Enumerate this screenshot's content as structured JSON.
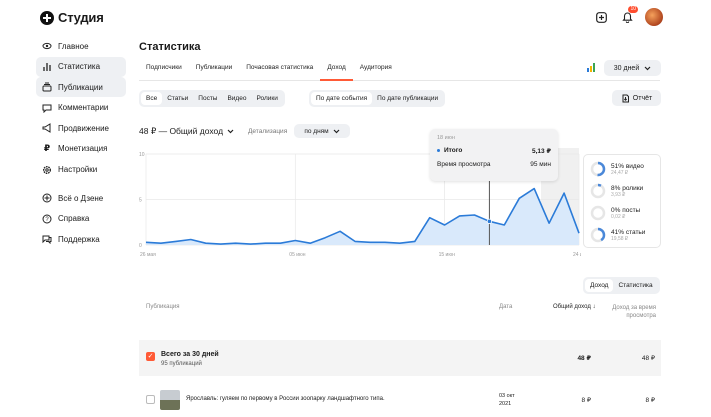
{
  "app": {
    "logo_text": "Студия",
    "notif_count": "10"
  },
  "sidebar": {
    "items": [
      {
        "label": "Главное",
        "icon": "eye-icon"
      },
      {
        "label": "Статистика",
        "icon": "stats-icon"
      },
      {
        "label": "Публикации",
        "icon": "publications-icon"
      },
      {
        "label": "Комментарии",
        "icon": "comment-icon"
      },
      {
        "label": "Продвижение",
        "icon": "megaphone-icon"
      },
      {
        "label": "Монетизация",
        "icon": "ruble-icon"
      },
      {
        "label": "Настройки",
        "icon": "gear-icon"
      },
      {
        "label": "Всё о Дзене",
        "icon": "zen-icon"
      },
      {
        "label": "Справка",
        "icon": "help-icon"
      },
      {
        "label": "Поддержка",
        "icon": "chat-icon"
      }
    ]
  },
  "page": {
    "title": "Статистика"
  },
  "tabs": [
    "Подписчики",
    "Публикации",
    "Почасовая статистика",
    "Доход",
    "Аудитория"
  ],
  "period": "30 дней",
  "filters": [
    "Все",
    "Статьи",
    "Посты",
    "Видео",
    "Ролики"
  ],
  "date_filters": [
    "По дате события",
    "По дате публикации"
  ],
  "report_label": "Отчёт",
  "income": {
    "title": "48 ₽ — Общий доход",
    "detail_label": "Детализация",
    "detail_value": "по дням"
  },
  "tooltip": {
    "date": "18 июн",
    "total_label": "Итого",
    "total_value": "5,13 ₽",
    "time_label": "Время просмотра",
    "time_value": "95 мин"
  },
  "chart_data": {
    "type": "area",
    "x": [
      "26 мая",
      "27 мая",
      "28 мая",
      "29 мая",
      "30 мая",
      "31 мая",
      "01 июн",
      "02 июн",
      "03 июн",
      "04 июн",
      "05 июн",
      "06 июн",
      "07 июн",
      "08 июн",
      "09 июн",
      "10 июн",
      "11 июн",
      "12 июн",
      "13 июн",
      "14 июн",
      "15 июн",
      "16 июн",
      "17 июн",
      "18 июн",
      "19 июн",
      "20 июн",
      "21 июн",
      "22 июн",
      "23 июн",
      "24 июн"
    ],
    "values": [
      0.3,
      0.2,
      0.4,
      0.6,
      0.2,
      0.1,
      0.2,
      0.1,
      0.2,
      0.2,
      0.5,
      0.2,
      0.8,
      1.5,
      0.4,
      0.3,
      0.3,
      0.2,
      0.4,
      3.0,
      2.2,
      3.2,
      3.3,
      2.6,
      2.2,
      5.13,
      6.2,
      2.4,
      5.7,
      1.3
    ],
    "x_ticks": [
      "26 мая",
      "05 июн",
      "15 июн",
      "24 июн"
    ],
    "y_ticks": [
      "0",
      "5",
      "10"
    ],
    "ylim": [
      0,
      10
    ],
    "color": "#2b7bd8",
    "fill": "#d9e9fb",
    "highlight_index": 23
  },
  "breakdown": [
    {
      "pct": "51% видео",
      "amount": "24,47 ₽",
      "frac": 0.51
    },
    {
      "pct": "8% ролики",
      "amount": "3,93 ₽",
      "frac": 0.08
    },
    {
      "pct": "0% посты",
      "amount": "0,02 ₽",
      "frac": 0.0
    },
    {
      "pct": "41% статьи",
      "amount": "19,58 ₽",
      "frac": 0.41
    }
  ],
  "bottom_tabs": [
    "Доход",
    "Статистика"
  ],
  "table": {
    "headers": {
      "pub": "Публикация",
      "date": "Дата",
      "income": "Общий доход",
      "time_income": "Доход за время просмотра"
    },
    "total": {
      "title": "Всего за 30 дней",
      "sub": "95 публикаций",
      "income": "48 ₽",
      "time_income": "48 ₽"
    },
    "row": {
      "title": "Ярославль: гуляем по первому в России зоопарку ландшафтного типа.",
      "date": "03 окт 2021",
      "income": "8 ₽",
      "time_income": "8 ₽"
    }
  },
  "colors": {
    "accent": "#ff5a36",
    "line": "#2b7bd8",
    "ring": "#4a88d9"
  }
}
